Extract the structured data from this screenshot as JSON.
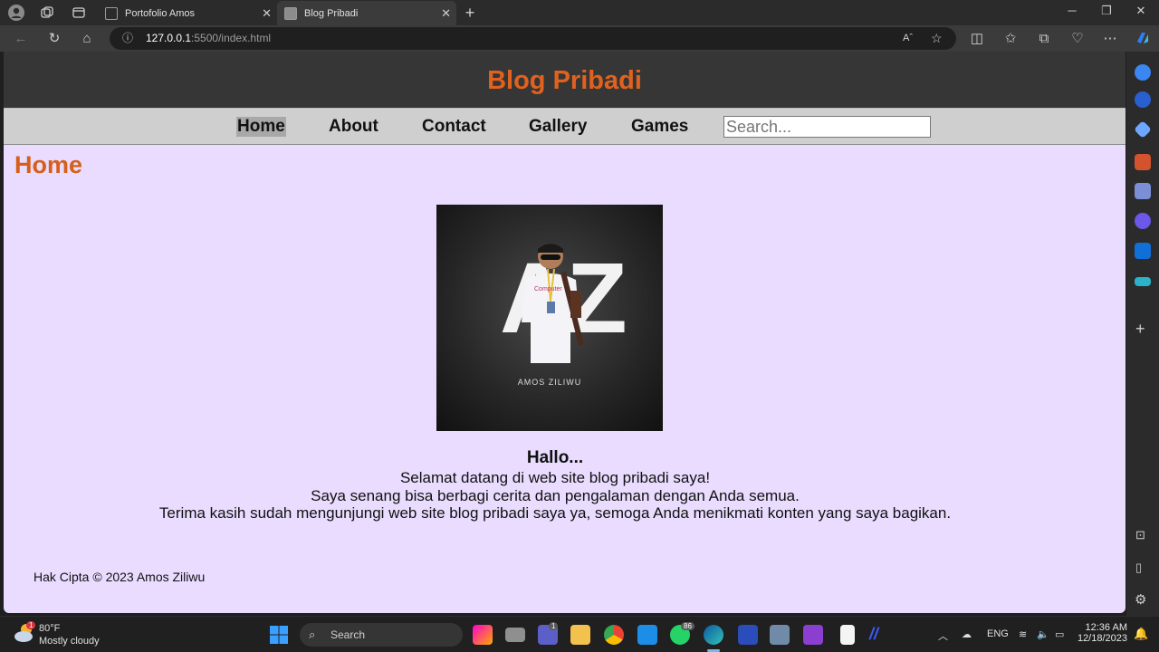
{
  "browser": {
    "tabs": [
      {
        "label": "Portofolio Amos"
      },
      {
        "label": "Blog Pribadi"
      }
    ],
    "url_host": "127.0.0.1",
    "url_rest": ":5500/index.html",
    "read_aloud_label": "Aˆ"
  },
  "site": {
    "title": "Blog Pribadi",
    "menu": {
      "items": [
        "Home",
        "About",
        "Contact",
        "Gallery",
        "Games"
      ],
      "search_placeholder": "Search..."
    },
    "section_title": "Home",
    "photo_caption": "AMOS ZILIWU",
    "photo_logo": "AZ",
    "greeting": "Hallo...",
    "lines": [
      "Selamat datang di web site blog pribadi saya!",
      "Saya senang bisa berbagi cerita dan pengalaman dengan Anda semua.",
      "Terima kasih sudah mengunjungi web site blog pribadi saya ya, semoga Anda menikmati konten yang saya bagikan."
    ],
    "footer": "Hak Cipta © 2023 Amos Ziliwu"
  },
  "taskbar": {
    "weather_temp": "80°F",
    "weather_desc": "Mostly cloudy",
    "weather_badge": "1",
    "search_label": "Search",
    "teams_badge": "1",
    "whatsapp_badge": "86",
    "lang": "ENG",
    "time": "12:36 AM",
    "date": "12/18/2023"
  },
  "colors": {
    "title_orange": "#e0621e",
    "page_bg": "#e9dcff",
    "header_bg": "#363636",
    "menu_bg": "#cfcfcf"
  }
}
